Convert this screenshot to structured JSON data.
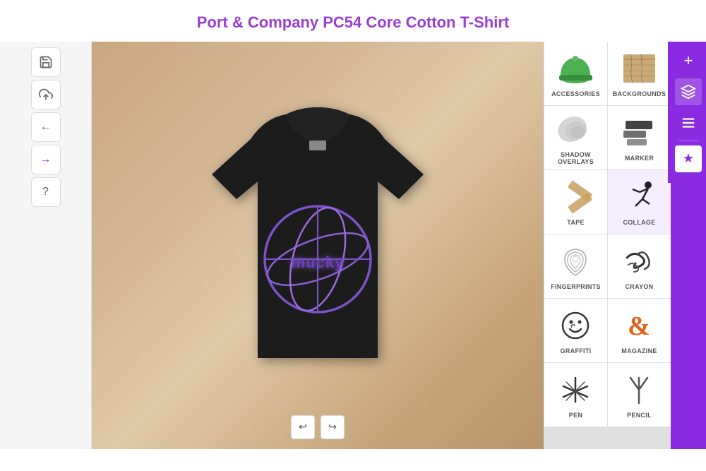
{
  "page": {
    "title": "Port & Company PC54 Core Cotton T-Shirt"
  },
  "toolbar": {
    "save_icon": "💾",
    "upload_icon": "☁",
    "back_icon": "←",
    "forward_icon": "→",
    "help_icon": "?"
  },
  "categories": [
    {
      "id": "accessories",
      "label": "ACCESSORIES",
      "icon_type": "hat",
      "active": false
    },
    {
      "id": "backgrounds",
      "label": "BACKGROUNDS",
      "icon_type": "wood",
      "active": false
    },
    {
      "id": "shadow_overlays",
      "label": "SHADOW OVERLAYS",
      "icon_type": "shadow",
      "active": false
    },
    {
      "id": "marker",
      "label": "MARKER",
      "icon_type": "marker",
      "active": false
    },
    {
      "id": "tape",
      "label": "TAPE",
      "icon_type": "tape",
      "active": false
    },
    {
      "id": "collage",
      "label": "COLLAGE",
      "icon_type": "collage",
      "active": true
    },
    {
      "id": "fingerprints",
      "label": "FINGERPRINTS",
      "icon_type": "fingerprint",
      "active": false
    },
    {
      "id": "crayon",
      "label": "CRAYON",
      "icon_type": "crayon",
      "active": false
    },
    {
      "id": "graffiti",
      "label": "GRAFFITI",
      "icon_type": "graffiti",
      "active": false
    },
    {
      "id": "magazine",
      "label": "MAGAZINE",
      "icon_type": "magazine",
      "active": false
    },
    {
      "id": "pen",
      "label": "PEN",
      "icon_type": "pen",
      "active": false
    },
    {
      "id": "pencil",
      "label": "PENCIL",
      "icon_type": "pencil",
      "active": false
    }
  ],
  "right_sidebar": {
    "add_label": "+",
    "layers_label": "⧉",
    "pattern_label": "≡",
    "star_label": "★"
  },
  "bottom_controls": {
    "undo_label": "↩",
    "redo_label": "↪"
  }
}
